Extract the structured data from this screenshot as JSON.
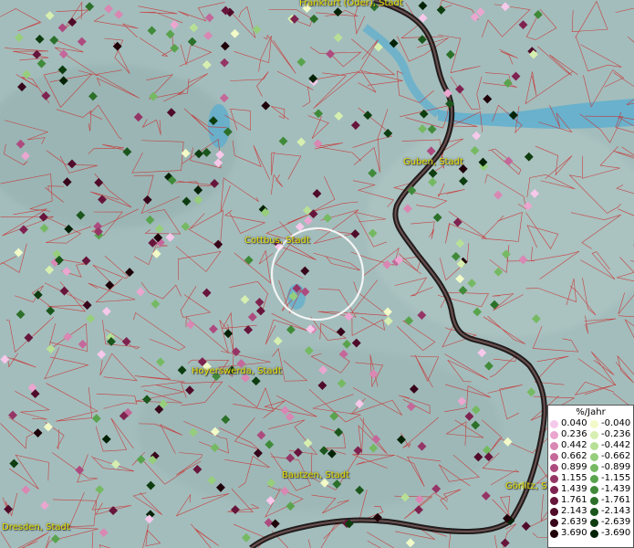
{
  "cities": [
    {
      "id": "frankfurt",
      "label": "Frankfurt (Oder), Stadt"
    },
    {
      "id": "guben",
      "label": "Guben, Stadt"
    },
    {
      "id": "cottbus",
      "label": "Cottbus, Stadt"
    },
    {
      "id": "hoyerswerda",
      "label": "Hoyerswerda, Stadt"
    },
    {
      "id": "bautzen",
      "label": "Bautzen, Stadt"
    },
    {
      "id": "goerlitz",
      "label": "Görlitz, S"
    },
    {
      "id": "dresden",
      "label": "Dresden, Stadt"
    }
  ],
  "legend": {
    "title": "%/Jahr",
    "positive": [
      {
        "value": "0.040",
        "color": "#f6c8ea"
      },
      {
        "value": "0.236",
        "color": "#eaa6cf"
      },
      {
        "value": "0.442",
        "color": "#d987b3"
      },
      {
        "value": "0.662",
        "color": "#c4689a"
      },
      {
        "value": "0.899",
        "color": "#ad4b7f"
      },
      {
        "value": "1.155",
        "color": "#953566"
      },
      {
        "value": "1.439",
        "color": "#7e2350"
      },
      {
        "value": "1.761",
        "color": "#67153b"
      },
      {
        "value": "2.143",
        "color": "#500b29"
      },
      {
        "value": "2.639",
        "color": "#38051a"
      },
      {
        "value": "3.690",
        "color": "#1f0109"
      }
    ],
    "negative": [
      {
        "value": "-0.040",
        "color": "#f2fac8"
      },
      {
        "value": "-0.236",
        "color": "#d6efb0"
      },
      {
        "value": "-0.442",
        "color": "#b7e096"
      },
      {
        "value": "-0.662",
        "color": "#96ce7c"
      },
      {
        "value": "-0.899",
        "color": "#76b963"
      },
      {
        "value": "-1.155",
        "color": "#59a34d"
      },
      {
        "value": "-1.439",
        "color": "#408a3a"
      },
      {
        "value": "-1.761",
        "color": "#2c702a"
      },
      {
        "value": "-2.143",
        "color": "#1b561c"
      },
      {
        "value": "-2.639",
        "color": "#0e3d10"
      },
      {
        "value": "-3.690",
        "color": "#042206"
      }
    ]
  },
  "colors": {
    "background": "#9fb9b8",
    "water": "#5aaed0",
    "border": "#1a0e0e",
    "district_lines": "#cc2a2a",
    "label": "#e6e000"
  }
}
